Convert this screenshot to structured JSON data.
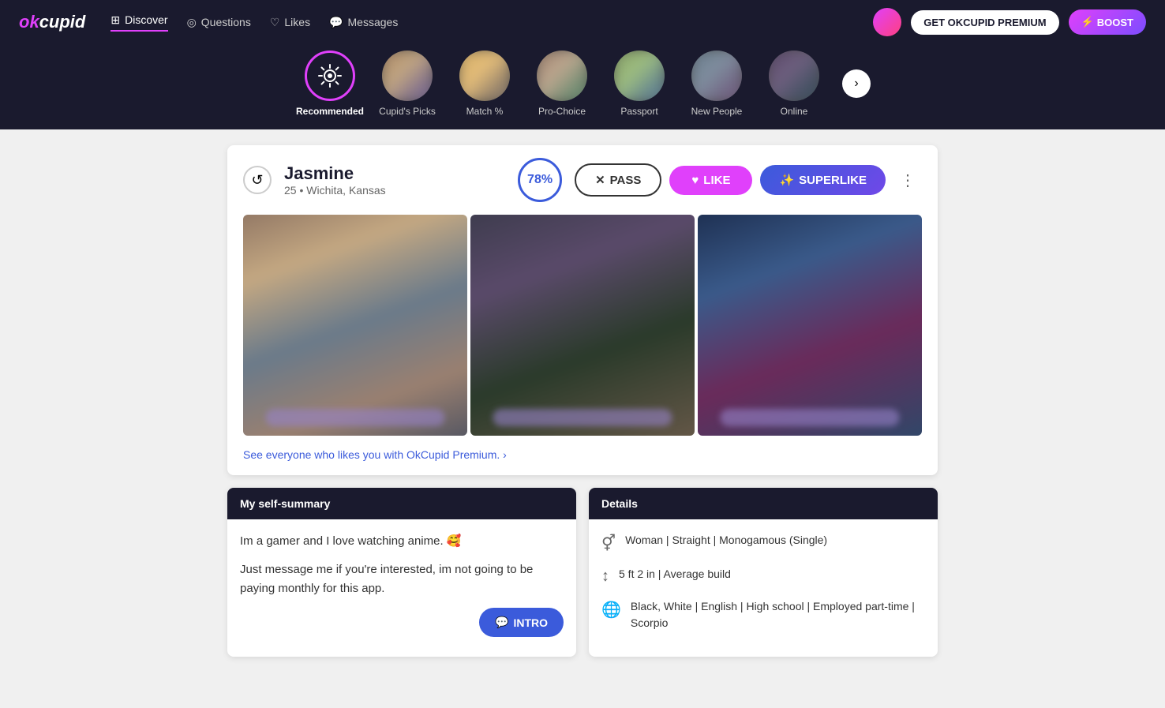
{
  "app": {
    "logo": "okcupid",
    "logo_accent": "ok"
  },
  "nav": {
    "links": [
      {
        "id": "discover",
        "label": "Discover",
        "active": true,
        "icon": "grid"
      },
      {
        "id": "questions",
        "label": "Questions",
        "active": false,
        "icon": "question"
      },
      {
        "id": "likes",
        "label": "Likes",
        "active": false,
        "icon": "heart"
      },
      {
        "id": "messages",
        "label": "Messages",
        "active": false,
        "icon": "chat"
      }
    ],
    "premium_button": "GET OKCUPID PREMIUM",
    "boost_button": "BOOST"
  },
  "categories": [
    {
      "id": "recommended",
      "label": "Recommended",
      "active": true,
      "icon": "sun"
    },
    {
      "id": "cupids-picks",
      "label": "Cupid's Picks",
      "active": false
    },
    {
      "id": "match",
      "label": "Match %",
      "active": false
    },
    {
      "id": "pro-choice",
      "label": "Pro-Choice",
      "active": false
    },
    {
      "id": "passport",
      "label": "Passport",
      "active": false
    },
    {
      "id": "new-people",
      "label": "New People",
      "active": false
    },
    {
      "id": "online",
      "label": "Online",
      "active": false
    }
  ],
  "profile": {
    "name": "Jasmine",
    "age": "25",
    "location": "Wichita, Kansas",
    "match_percent": "78%",
    "pass_label": "PASS",
    "like_label": "LIKE",
    "superlike_label": "SUPERLIKE",
    "intro_label": "INTRO",
    "premium_link": "See everyone who likes you with OkCupid Premium. ›",
    "self_summary_header": "My self-summary",
    "self_summary_line1": "Im a gamer and I love watching anime. 🥰",
    "self_summary_line2": "Just message me if you're interested, im not going to be paying monthly for this app.",
    "details_header": "Details",
    "details": [
      {
        "icon": "gender",
        "text": "Woman | Straight | Monogamous (Single)"
      },
      {
        "icon": "height",
        "text": "5 ft 2 in | Average build"
      },
      {
        "icon": "globe",
        "text": "Black, White | English | High school | Employed part-time | Scorpio"
      }
    ]
  }
}
